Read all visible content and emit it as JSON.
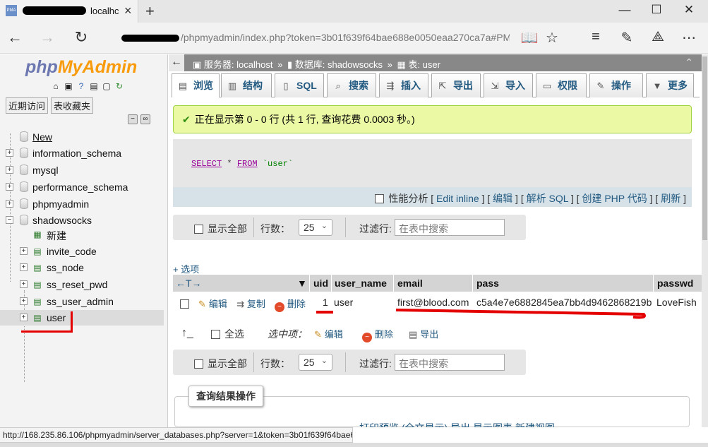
{
  "browser": {
    "tab_title": "localhc",
    "favicon_text": "PMA",
    "url": "/phpmyadmin/index.php?token=3b01f639f64bae688e0050eaa270ca7a#PMAURL-2:"
  },
  "sidebar": {
    "logo_a": "php",
    "logo_b": "MyAdmin",
    "tab_recent": "近期访问",
    "tab_favorites": "表收藏夹",
    "tree": [
      {
        "label": "New"
      },
      {
        "label": "information_schema"
      },
      {
        "label": "mysql"
      },
      {
        "label": "performance_schema"
      },
      {
        "label": "phpmyadmin"
      },
      {
        "label": "shadowsocks"
      },
      {
        "label": "新建"
      },
      {
        "label": "invite_code"
      },
      {
        "label": "ss_node"
      },
      {
        "label": "ss_reset_pwd"
      },
      {
        "label": "ss_user_admin"
      },
      {
        "label": "user"
      }
    ]
  },
  "breadcrumb": {
    "server": "服务器: localhost",
    "database": "数据库: shadowsocks",
    "table": "表: user",
    "sep": "»"
  },
  "tabs": [
    {
      "label": "浏览"
    },
    {
      "label": "结构"
    },
    {
      "label": "SQL"
    },
    {
      "label": "搜索"
    },
    {
      "label": "插入"
    },
    {
      "label": "导出"
    },
    {
      "label": "导入"
    },
    {
      "label": "权限"
    },
    {
      "label": "操作"
    },
    {
      "label": "更多"
    }
  ],
  "success_message": "正在显示第 0 - 0 行 (共 1 行, 查询花费 0.0003 秒。)",
  "sql": {
    "kw1": "SELECT",
    "mid": " * ",
    "kw2": "FROM",
    "table": " `user`"
  },
  "sql_links": {
    "profiling": "性能分析",
    "edit_inline": "Edit inline",
    "edit": "编辑",
    "explain": "解析 SQL",
    "create_php": "创建 PHP 代码",
    "refresh": "刷新"
  },
  "navigation": {
    "show_all": "显示全部",
    "rows_label": "行数：",
    "rows_value": "25",
    "filter_label": "过滤行:",
    "filter_placeholder": "在表中搜索"
  },
  "options_link": "+ 选项",
  "sort_arrows": "←T→",
  "columns": [
    "uid",
    "user_name",
    "email",
    "pass",
    "passwd"
  ],
  "row": {
    "edit": "编辑",
    "copy": "复制",
    "delete": "删除",
    "uid": "1",
    "user_name": "user",
    "email": "first@blood.com",
    "pass": "c5a4e7e6882845ea7bb4d9462868219b",
    "passwd": "LoveFish"
  },
  "bulk": {
    "check_all": "全选",
    "with_selected": "选中项：",
    "edit": "编辑",
    "delete": "删除",
    "export": "导出"
  },
  "result_ops": {
    "legend": "查询结果操作",
    "links": "打印预览 (全文显示)   导出   显示图表   新建视图"
  },
  "status_url": "http://168.235.86.106/phpmyadmin/server_databases.php?server=1&token=3b01f639f64bae6",
  "colors": {
    "accent": "#235a81",
    "success_bg": "#ebf8a4",
    "annotation_red": "#e40000"
  }
}
